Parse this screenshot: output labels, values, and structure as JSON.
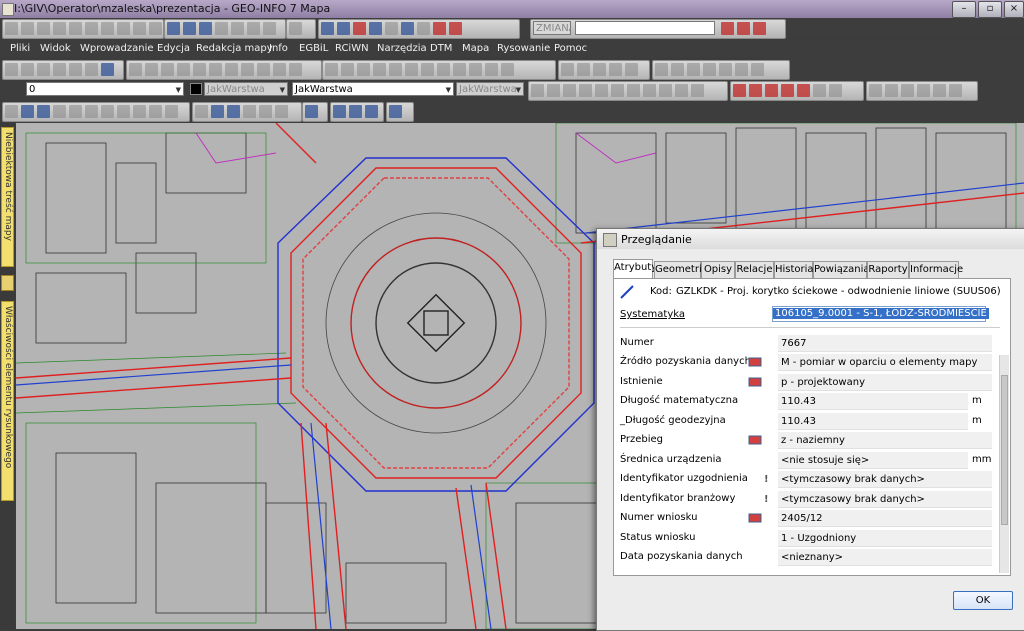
{
  "window": {
    "title": "I:\\GIV\\Operator\\mzaleska\\prezentacja - GEO-INFO 7 Mapa"
  },
  "toolbar": {
    "zmiana_placeholder": "ZMIANA"
  },
  "menu": [
    "Pliki",
    "Widok",
    "Wprowadzanie",
    "Edycja",
    "Redakcja mapy",
    "Info",
    "EGBiL",
    "RCiWN",
    "Narzędzia",
    "DTM",
    "Mapa",
    "Rysowanie",
    "Pomoc"
  ],
  "layer_bar": {
    "layer_value": "0",
    "color_label": "JakWarstwa",
    "linetype_value": "JakWarstwa",
    "lineweight_value": "JakWarstwa"
  },
  "sidebar": {
    "tab1": "Niebiektowa treść mapy",
    "tab2": "Właściwości elementu rysunkowego"
  },
  "dialog": {
    "title": "Przeglądanie",
    "tabs": [
      "Atrybuty",
      "Geometria",
      "Opisy",
      "Relacje",
      "Historia",
      "Powiązania",
      "Raporty",
      "Informacje"
    ],
    "kod_label": "Kod:",
    "kod_value": "GZLKDK - Proj. korytko ściekowe - odwodnienie liniowe (SUUS06)",
    "systematyka_label": "Systematyka",
    "systematyka_value": "106105_9.0001 - S-1, ŁÓDŹ-ŚRÓDMIEŚCIE",
    "fields": [
      {
        "label": "Numer",
        "value": "7667",
        "unit": ""
      },
      {
        "label": "Źródło pozyskania danych",
        "value": "M - pomiar w oparciu o elementy mapy",
        "unit": ""
      },
      {
        "label": "Istnienie",
        "value": "p - projektowany",
        "unit": ""
      },
      {
        "label": "Długość matematyczna",
        "value": "110.43",
        "unit": "m"
      },
      {
        "label": "_Długość geodezyjna",
        "value": "110.43",
        "unit": "m"
      },
      {
        "label": "Przebieg",
        "value": "z - naziemny",
        "unit": ""
      },
      {
        "label": "Średnica urządzenia",
        "value": "<nie stosuje się>",
        "unit": "mm"
      },
      {
        "label": "Identyfikator uzgodnienia",
        "value": "<tymczasowy brak danych>",
        "unit": ""
      },
      {
        "label": "Identyfikator branżowy",
        "value": "<tymczasowy brak danych>",
        "unit": ""
      },
      {
        "label": "Numer wniosku",
        "value": "2405/12",
        "unit": ""
      },
      {
        "label": "Status wniosku",
        "value": "1 - Uzgodniony",
        "unit": ""
      },
      {
        "label": "Data pozyskania danych",
        "value": "<nieznany>",
        "unit": ""
      }
    ],
    "ok_label": "OK"
  }
}
